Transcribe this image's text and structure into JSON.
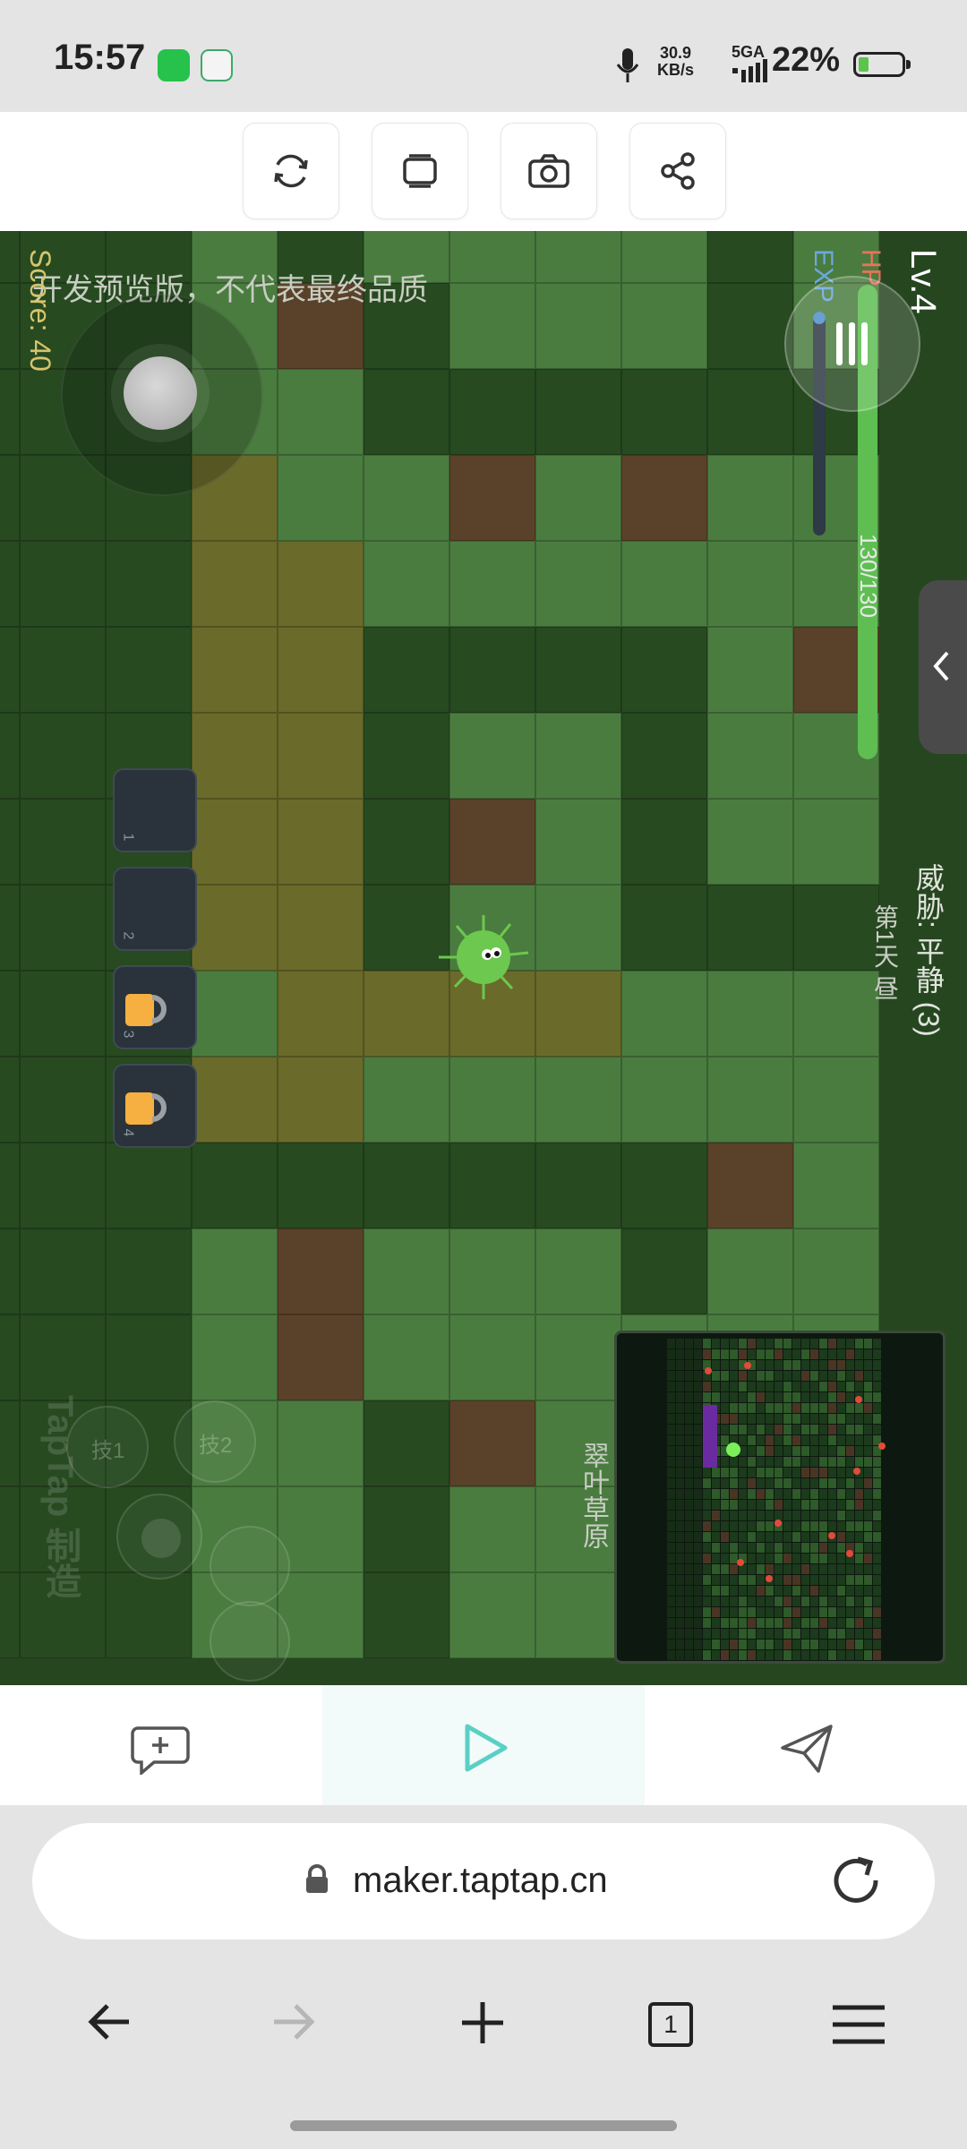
{
  "status": {
    "time": "15:57",
    "net_speed_top": "30.9",
    "net_speed_unit": "KB/s",
    "network": "5GA",
    "battery": "22%"
  },
  "toolbar": {
    "buttons": [
      "refresh-icon",
      "multi-window-icon",
      "camera-icon",
      "share-icon"
    ]
  },
  "game": {
    "watermark": "开发预览版，不代表最终品质",
    "score": "Score: 40",
    "level": "Lv.4",
    "hp_label": "HP",
    "exp_label": "EXP",
    "hp_text": "130/130",
    "hp_fraction": 1.0,
    "exp_fraction": 0.03,
    "threat": "威胁: 平静 (3)",
    "day": "第1天 昼",
    "zone": "翠叶草原",
    "slots": [
      "1",
      "2",
      "3",
      "4"
    ],
    "skill1": "技1",
    "skill2": "技2",
    "brand": "TapTap 制造",
    "colors": {
      "dark_grass": "#274a21",
      "light_grass": "#4a7c3f",
      "dirt": "#5a4129",
      "sand": "#6a6a2a",
      "player": "#6cc84e",
      "lock": "#f5b041"
    }
  },
  "bottom_tabs": [
    "comment-add-icon",
    "play-icon",
    "send-icon"
  ],
  "browser": {
    "url": "maker.taptap.cn",
    "nav": [
      "back-icon",
      "forward-icon",
      "new-tab-icon",
      "tabs-count-icon",
      "menu-icon"
    ],
    "tab_count": "1"
  }
}
